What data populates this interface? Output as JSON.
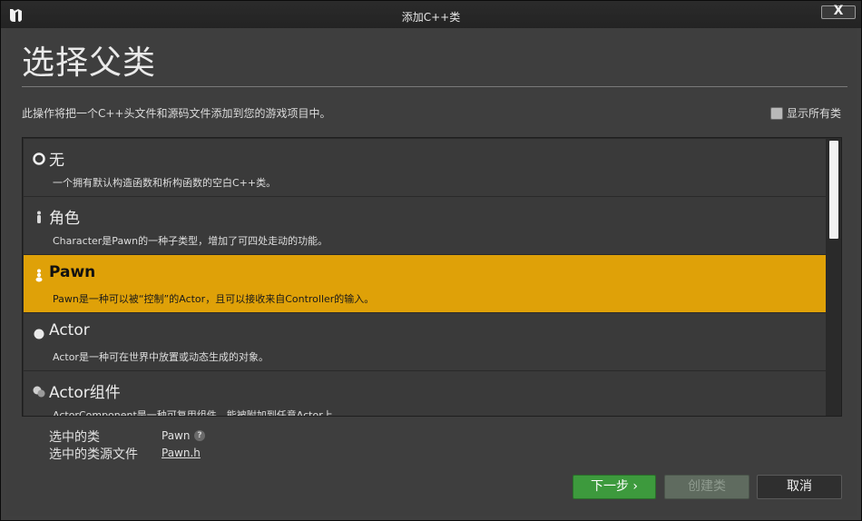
{
  "window": {
    "title": "添加C++类",
    "close_label": "X"
  },
  "header": {
    "title": "选择父类",
    "description": "此操作将把一个C++头文件和源码文件添加到您的游戏项目中。",
    "show_all_label": "显示所有类",
    "show_all_checked": false
  },
  "classes": [
    {
      "name": "无",
      "desc": "一个拥有默认构造函数和析构函数的空白C++类。",
      "icon": "circle-outline-icon",
      "selected": false
    },
    {
      "name": "角色",
      "desc": "Character是Pawn的一种子类型，增加了可四处走动的功能。",
      "icon": "character-icon",
      "selected": false
    },
    {
      "name": "Pawn",
      "desc": "Pawn是一种可以被“控制”的Actor，且可以接收来自Controller的输入。",
      "icon": "pawn-icon",
      "selected": true
    },
    {
      "name": "Actor",
      "desc": "Actor是一种可在世界中放置或动态生成的对象。",
      "icon": "sphere-icon",
      "selected": false
    },
    {
      "name": "Actor组件",
      "desc": "ActorComponent是一种可复用组件，能被附加到任意Actor上",
      "icon": "component-icon",
      "selected": false
    }
  ],
  "selection": {
    "class_label": "选中的类",
    "class_value": "Pawn",
    "source_label": "选中的类源文件",
    "source_value": "Pawn.h"
  },
  "buttons": {
    "next": "下一步 ›",
    "create": "创建类",
    "cancel": "取消"
  },
  "colors": {
    "accent_selected": "#dfa108",
    "next_button": "#3d9a3d"
  }
}
